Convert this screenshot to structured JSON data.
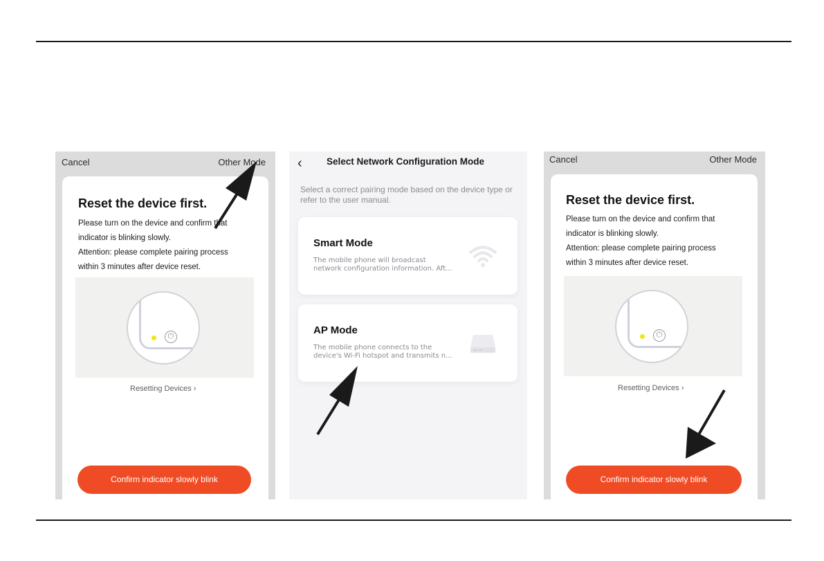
{
  "screens": [
    {
      "cancel_label": "Cancel",
      "other_mode_label": "Other Mode",
      "title": "Reset the device first.",
      "body_lines": [
        "Please turn on the device and confirm that",
        "indicator is blinking slowly.",
        "Attention: please complete pairing process",
        "within 3 minutes after device reset."
      ],
      "resetting_link": "Resetting Devices",
      "confirm_button": "Confirm indicator slowly blink"
    },
    {
      "title": "Select Network Configuration Mode",
      "description": "Select a correct pairing mode based on the device type or refer to the user manual.",
      "modes": [
        {
          "title": "Smart Mode",
          "desc_line1": "The mobile phone will broadcast",
          "desc_line2": "network configuration information. Aft...",
          "icon": "wifi-icon"
        },
        {
          "title": "AP Mode",
          "desc_line1": "The mobile phone connects to the",
          "desc_line2": "device's Wi-Fi hotspot and transmits n...",
          "icon": "router-icon"
        }
      ]
    },
    {
      "cancel_label": "Cancel",
      "other_mode_label": "Other Mode",
      "title": "Reset the device first.",
      "body_lines": [
        "Please turn on the device and confirm that",
        "indicator is blinking slowly.",
        "Attention: please complete pairing process",
        "within 3 minutes after device reset."
      ],
      "resetting_link": "Resetting Devices",
      "confirm_button": "Confirm indicator slowly blink"
    }
  ],
  "colors": {
    "accent": "#ef4c25",
    "led": "#f0e617",
    "arrow": "#1a1a1a"
  },
  "icons": {
    "chevron": "›",
    "back": "‹",
    "power": "⏻"
  }
}
